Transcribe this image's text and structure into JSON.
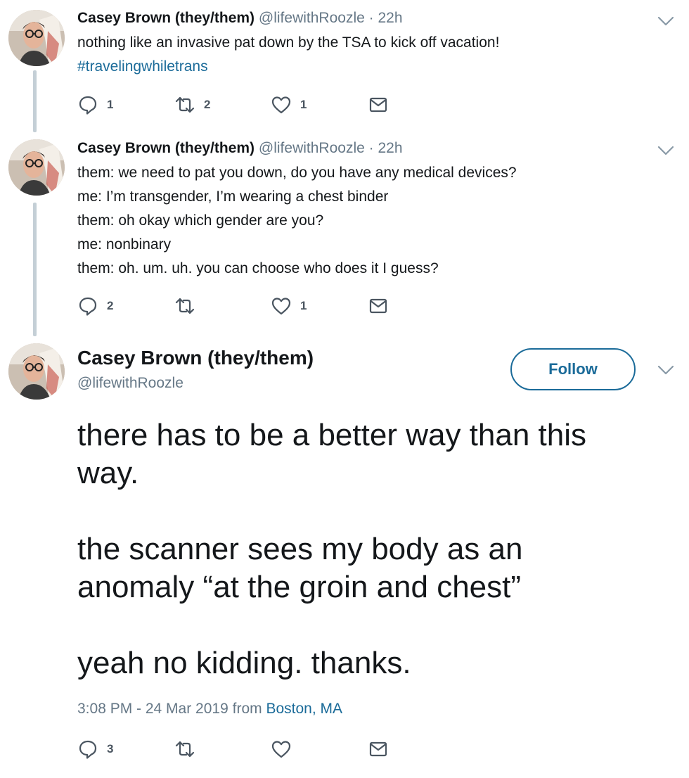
{
  "tweets": [
    {
      "name": "Casey Brown (they/them)",
      "handle": "@lifewithRoozle",
      "dot": "·",
      "time": "22h",
      "lines": [
        "nothing like an invasive pat down by the TSA to kick off vacation!"
      ],
      "hashtag": "#travelingwhiletrans",
      "replies": "1",
      "retweets": "2",
      "likes": "1"
    },
    {
      "name": "Casey Brown (they/them)",
      "handle": "@lifewithRoozle",
      "dot": "·",
      "time": "22h",
      "lines": [
        "them: we need to pat you down, do you have any medical devices?",
        "me: I’m transgender, I’m wearing a chest binder",
        "them: oh okay which gender are you?",
        "me: nonbinary",
        "them: oh. um. uh. you can choose who does it I guess?"
      ],
      "replies": "2",
      "retweets": "",
      "likes": "1"
    }
  ],
  "main_tweet": {
    "name": "Casey Brown (they/them)",
    "handle": "@lifewithRoozle",
    "follow_label": "Follow",
    "paragraphs": [
      [
        "there has to be a better way than this",
        "way."
      ],
      [
        "the scanner sees my body as an",
        "anomaly “at the groin and chest”"
      ],
      [
        "yeah no kidding. thanks."
      ]
    ],
    "timestamp": "3:08 PM - 24 Mar 2019 from",
    "location": "Boston, MA",
    "replies": "3",
    "retweets": "",
    "likes": ""
  },
  "icons": {
    "reply": "reply-icon",
    "retweet": "retweet-icon",
    "like": "heart-icon",
    "message": "direct-message-icon",
    "menu": "chevron-down-icon"
  },
  "colors": {
    "link": "#1b6b99",
    "muted": "#657786",
    "thread_line": "#c4cfd6",
    "text": "#14171a"
  }
}
